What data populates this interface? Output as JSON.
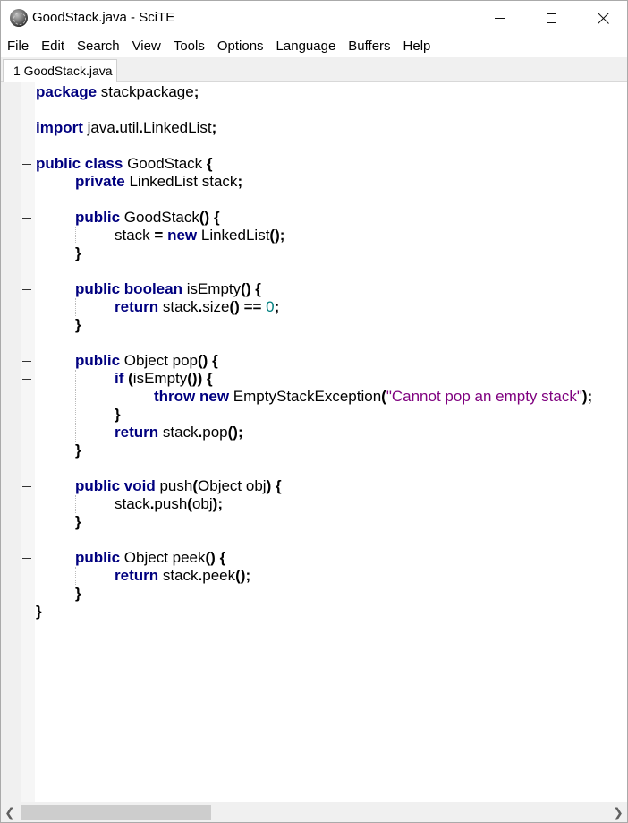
{
  "window": {
    "title": "GoodStack.java - SciTE",
    "app_icon": "scite-app-icon",
    "controls": {
      "minimize": "minimize-icon",
      "maximize": "maximize-icon",
      "close": "close-icon"
    }
  },
  "menu": [
    {
      "label": "File"
    },
    {
      "label": "Edit"
    },
    {
      "label": "Search"
    },
    {
      "label": "View"
    },
    {
      "label": "Tools"
    },
    {
      "label": "Options"
    },
    {
      "label": "Language"
    },
    {
      "label": "Buffers"
    },
    {
      "label": "Help"
    }
  ],
  "tabs": [
    {
      "label": "1 GoodStack.java",
      "active": true
    }
  ],
  "editor": {
    "language": "java",
    "colors": {
      "keyword": "#00007f",
      "string": "#7f007f",
      "number": "#007f7f",
      "operator": "#000000",
      "gutter": "#f0f0f0"
    },
    "lines": [
      [
        {
          "t": "kw",
          "v": "package"
        },
        {
          "t": "id",
          "v": " stackpackage"
        },
        {
          "t": "op",
          "v": ";"
        }
      ],
      [],
      [
        {
          "t": "kw",
          "v": "import"
        },
        {
          "t": "id",
          "v": " java"
        },
        {
          "t": "op",
          "v": "."
        },
        {
          "t": "id",
          "v": "util"
        },
        {
          "t": "op",
          "v": "."
        },
        {
          "t": "id",
          "v": "LinkedList"
        },
        {
          "t": "op",
          "v": ";"
        }
      ],
      [],
      [
        {
          "t": "kw",
          "v": "public"
        },
        {
          "t": "id",
          "v": " "
        },
        {
          "t": "kw",
          "v": "class"
        },
        {
          "t": "id",
          "v": " GoodStack "
        },
        {
          "t": "op",
          "v": "{"
        }
      ],
      [
        {
          "t": "id",
          "v": "\t"
        },
        {
          "t": "kw",
          "v": "private"
        },
        {
          "t": "id",
          "v": " LinkedList stack"
        },
        {
          "t": "op",
          "v": ";"
        }
      ],
      [],
      [
        {
          "t": "id",
          "v": "\t"
        },
        {
          "t": "kw",
          "v": "public"
        },
        {
          "t": "id",
          "v": " GoodStack"
        },
        {
          "t": "op",
          "v": "()"
        },
        {
          "t": "id",
          "v": " "
        },
        {
          "t": "op",
          "v": "{"
        }
      ],
      [
        {
          "t": "id",
          "v": "\t\tstack "
        },
        {
          "t": "op",
          "v": "="
        },
        {
          "t": "id",
          "v": " "
        },
        {
          "t": "kw",
          "v": "new"
        },
        {
          "t": "id",
          "v": " LinkedList"
        },
        {
          "t": "op",
          "v": "();"
        }
      ],
      [
        {
          "t": "id",
          "v": "\t"
        },
        {
          "t": "op",
          "v": "}"
        }
      ],
      [],
      [
        {
          "t": "id",
          "v": "\t"
        },
        {
          "t": "kw",
          "v": "public"
        },
        {
          "t": "id",
          "v": " "
        },
        {
          "t": "kw",
          "v": "boolean"
        },
        {
          "t": "id",
          "v": " isEmpty"
        },
        {
          "t": "op",
          "v": "()"
        },
        {
          "t": "id",
          "v": " "
        },
        {
          "t": "op",
          "v": "{"
        }
      ],
      [
        {
          "t": "id",
          "v": "\t\t"
        },
        {
          "t": "kw",
          "v": "return"
        },
        {
          "t": "id",
          "v": " stack"
        },
        {
          "t": "op",
          "v": "."
        },
        {
          "t": "id",
          "v": "size"
        },
        {
          "t": "op",
          "v": "()"
        },
        {
          "t": "id",
          "v": " "
        },
        {
          "t": "op",
          "v": "=="
        },
        {
          "t": "id",
          "v": " "
        },
        {
          "t": "num",
          "v": "0"
        },
        {
          "t": "op",
          "v": ";"
        }
      ],
      [
        {
          "t": "id",
          "v": "\t"
        },
        {
          "t": "op",
          "v": "}"
        }
      ],
      [],
      [
        {
          "t": "id",
          "v": "\t"
        },
        {
          "t": "kw",
          "v": "public"
        },
        {
          "t": "id",
          "v": " Object pop"
        },
        {
          "t": "op",
          "v": "()"
        },
        {
          "t": "id",
          "v": " "
        },
        {
          "t": "op",
          "v": "{"
        }
      ],
      [
        {
          "t": "id",
          "v": "\t\t"
        },
        {
          "t": "kw",
          "v": "if"
        },
        {
          "t": "id",
          "v": " "
        },
        {
          "t": "op",
          "v": "("
        },
        {
          "t": "id",
          "v": "isEmpty"
        },
        {
          "t": "op",
          "v": "())"
        },
        {
          "t": "id",
          "v": " "
        },
        {
          "t": "op",
          "v": "{"
        }
      ],
      [
        {
          "t": "id",
          "v": "\t\t\t"
        },
        {
          "t": "kw",
          "v": "throw"
        },
        {
          "t": "id",
          "v": " "
        },
        {
          "t": "kw",
          "v": "new"
        },
        {
          "t": "id",
          "v": " EmptyStackException"
        },
        {
          "t": "op",
          "v": "("
        },
        {
          "t": "str",
          "v": "\"Cannot pop an empty stack\""
        },
        {
          "t": "op",
          "v": ");"
        }
      ],
      [
        {
          "t": "id",
          "v": "\t\t"
        },
        {
          "t": "op",
          "v": "}"
        }
      ],
      [
        {
          "t": "id",
          "v": "\t\t"
        },
        {
          "t": "kw",
          "v": "return"
        },
        {
          "t": "id",
          "v": " stack"
        },
        {
          "t": "op",
          "v": "."
        },
        {
          "t": "id",
          "v": "pop"
        },
        {
          "t": "op",
          "v": "();"
        }
      ],
      [
        {
          "t": "id",
          "v": "\t"
        },
        {
          "t": "op",
          "v": "}"
        }
      ],
      [],
      [
        {
          "t": "id",
          "v": "\t"
        },
        {
          "t": "kw",
          "v": "public"
        },
        {
          "t": "id",
          "v": " "
        },
        {
          "t": "kw",
          "v": "void"
        },
        {
          "t": "id",
          "v": " push"
        },
        {
          "t": "op",
          "v": "("
        },
        {
          "t": "id",
          "v": "Object obj"
        },
        {
          "t": "op",
          "v": ")"
        },
        {
          "t": "id",
          "v": " "
        },
        {
          "t": "op",
          "v": "{"
        }
      ],
      [
        {
          "t": "id",
          "v": "\t\tstack"
        },
        {
          "t": "op",
          "v": "."
        },
        {
          "t": "id",
          "v": "push"
        },
        {
          "t": "op",
          "v": "("
        },
        {
          "t": "id",
          "v": "obj"
        },
        {
          "t": "op",
          "v": ");"
        }
      ],
      [
        {
          "t": "id",
          "v": "\t"
        },
        {
          "t": "op",
          "v": "}"
        }
      ],
      [],
      [
        {
          "t": "id",
          "v": "\t"
        },
        {
          "t": "kw",
          "v": "public"
        },
        {
          "t": "id",
          "v": " Object peek"
        },
        {
          "t": "op",
          "v": "()"
        },
        {
          "t": "id",
          "v": " "
        },
        {
          "t": "op",
          "v": "{"
        }
      ],
      [
        {
          "t": "id",
          "v": "\t\t"
        },
        {
          "t": "kw",
          "v": "return"
        },
        {
          "t": "id",
          "v": " stack"
        },
        {
          "t": "op",
          "v": "."
        },
        {
          "t": "id",
          "v": "peek"
        },
        {
          "t": "op",
          "v": "();"
        }
      ],
      [
        {
          "t": "id",
          "v": "\t"
        },
        {
          "t": "op",
          "v": "}"
        }
      ],
      [
        {
          "t": "op",
          "v": "}"
        }
      ]
    ]
  },
  "scrollbar": {
    "left_arrow": "chevron-left-icon",
    "right_arrow": "chevron-right-icon"
  }
}
